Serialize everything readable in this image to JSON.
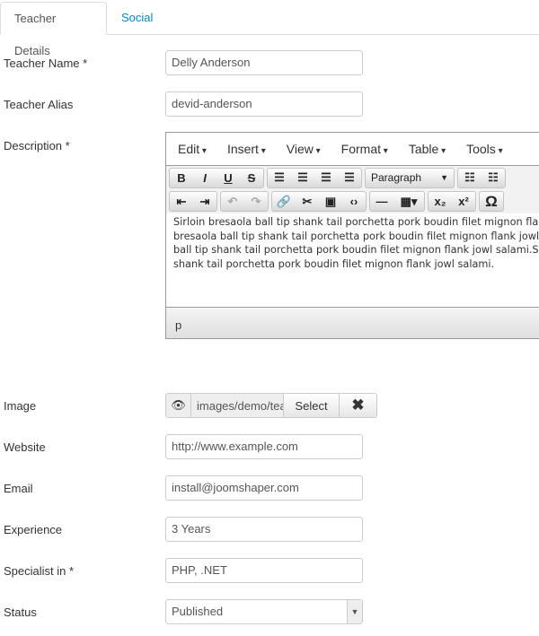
{
  "tabs": [
    {
      "label": "Teacher Details"
    },
    {
      "label": "Social"
    }
  ],
  "fields": {
    "name": {
      "label": "Teacher Name *",
      "value": "Delly Anderson"
    },
    "alias": {
      "label": "Teacher Alias",
      "value": "devid-anderson"
    },
    "description": {
      "label": "Description *"
    },
    "image": {
      "label": "Image",
      "value": "images/demo/teachers",
      "select": "Select",
      "clear": "✖"
    },
    "website": {
      "label": "Website",
      "value": "http://www.example.com"
    },
    "email": {
      "label": "Email",
      "value": "install@joomshaper.com"
    },
    "experience": {
      "label": "Experience",
      "value": "3 Years"
    },
    "specialist": {
      "label": "Specialist in *",
      "value": "PHP, .NET"
    },
    "status": {
      "label": "Status",
      "value": "Published"
    }
  },
  "editor": {
    "menus": [
      "Edit",
      "Insert",
      "View",
      "Format",
      "Table",
      "Tools"
    ],
    "format_select": "Paragraph",
    "content": "Sirloin bresaola ball tip shank tail porchetta pork boudin filet mignon flank jowl salami. Sirloin bresaola ball tip shank tail porchetta pork boudin filet mignon flank jowl salami. Sirloin bresaola ball tip shank tail porchetta pork boudin filet mignon flank jowl salami.Sirloin bresaola ball tip shank tail porchetta pork boudin filet mignon flank jowl salami.",
    "path": "p"
  }
}
